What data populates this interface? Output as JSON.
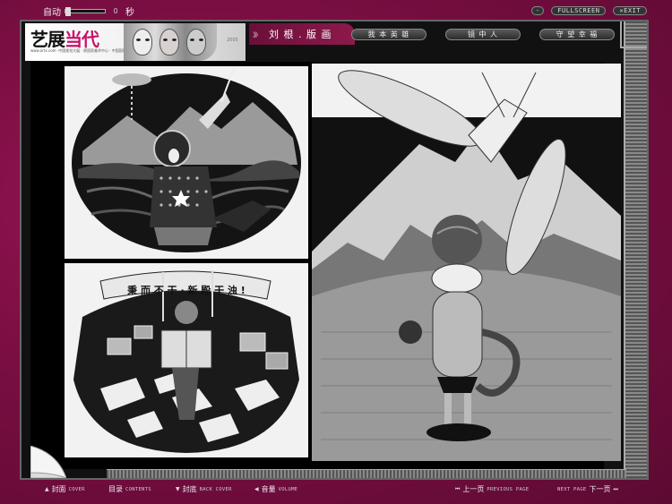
{
  "top": {
    "autoplay_label": "自动",
    "autoplay_value": "0",
    "seconds_label": "秒",
    "fullscreen": "FULLSCREEN",
    "exit": "EXIT",
    "minimize": "-"
  },
  "logo": {
    "text_a": "艺展",
    "text_b": "当代",
    "site": "www.artx.com",
    "tagline": "·中国视觉大展 · 原国家美术中心 · 中国国际优秀艺术展",
    "year": "2005"
  },
  "header": {
    "section_title": "刘 根 . 版 画",
    "arrows": "〉〉〉",
    "tabs": [
      "我 本 英 雄",
      "镜 中 人",
      "守 望 幸 福"
    ]
  },
  "artwork": {
    "banner_text": "秉 而 不 干 · 新 殿 干 浊 !"
  },
  "bottom_nav": {
    "cover": {
      "cn": "封面",
      "en": "COVER",
      "icon": "up-triangle-icon"
    },
    "contents": {
      "cn": "目录",
      "en": "CONTENTS"
    },
    "back_cover": {
      "cn": "封底",
      "en": "BACK COVER",
      "icon": "down-triangle-icon"
    },
    "volume": {
      "cn": "音量",
      "en": "VOLUME",
      "icon": "speaker-icon"
    },
    "previous": {
      "cn": "上一页",
      "en": "PREVIOUS PAGE",
      "icon": "rewind-icon"
    },
    "next": {
      "cn": "下一页",
      "en": "NEXT PAGE",
      "icon": "forward-icon"
    }
  },
  "colors": {
    "background": "#8d1550",
    "accent": "#c8136a",
    "frame": "#111111"
  }
}
